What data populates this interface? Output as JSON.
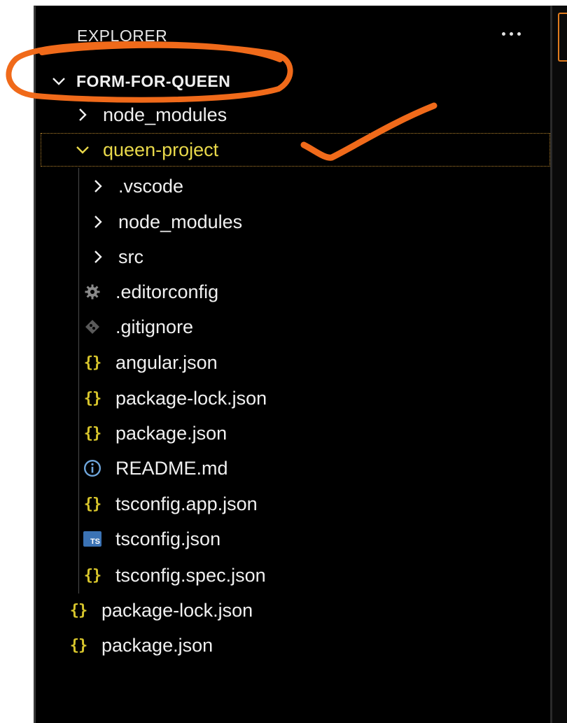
{
  "explorer": {
    "title": "EXPLORER",
    "more_icon": "ellipsis-icon"
  },
  "tree": {
    "root": {
      "label": "FORM-FOR-QUEEN",
      "expanded": true
    },
    "items": [
      {
        "label": "node_modules",
        "type": "folder",
        "expanded": false,
        "depth": 1
      },
      {
        "label": "queen-project",
        "type": "folder",
        "expanded": true,
        "depth": 1,
        "selected": true
      },
      {
        "label": ".vscode",
        "type": "folder",
        "expanded": false,
        "depth": 2
      },
      {
        "label": "node_modules",
        "type": "folder",
        "expanded": false,
        "depth": 2
      },
      {
        "label": "src",
        "type": "folder",
        "expanded": false,
        "depth": 2
      },
      {
        "label": ".editorconfig",
        "type": "file",
        "icon": "gear-icon",
        "depth": 2
      },
      {
        "label": ".gitignore",
        "type": "file",
        "icon": "git-icon",
        "depth": 2
      },
      {
        "label": "angular.json",
        "type": "file",
        "icon": "json-braces-icon",
        "depth": 2
      },
      {
        "label": "package-lock.json",
        "type": "file",
        "icon": "json-braces-icon",
        "depth": 2
      },
      {
        "label": "package.json",
        "type": "file",
        "icon": "json-braces-icon",
        "depth": 2
      },
      {
        "label": "README.md",
        "type": "file",
        "icon": "info-icon",
        "depth": 2
      },
      {
        "label": "tsconfig.app.json",
        "type": "file",
        "icon": "json-braces-icon",
        "depth": 2
      },
      {
        "label": "tsconfig.json",
        "type": "file",
        "icon": "typescript-icon",
        "depth": 2
      },
      {
        "label": "tsconfig.spec.json",
        "type": "file",
        "icon": "json-braces-icon",
        "depth": 2
      },
      {
        "label": "package-lock.json",
        "type": "file",
        "icon": "json-braces-icon",
        "depth": 1
      },
      {
        "label": "package.json",
        "type": "file",
        "icon": "json-braces-icon",
        "depth": 1
      }
    ]
  },
  "icons": {
    "json_glyph": "{}",
    "ts_glyph": "TS"
  },
  "colors": {
    "background": "#000000",
    "text": "#f0f0f0",
    "selected_text": "#e8d84a",
    "json_icon": "#d8c62c",
    "annotation": "#f06a1a"
  }
}
